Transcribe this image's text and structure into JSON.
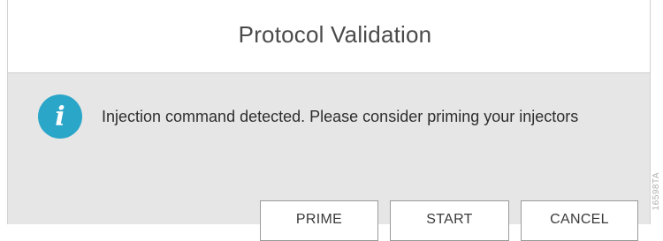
{
  "dialog": {
    "title": "Protocol Validation",
    "icon": "info-icon",
    "icon_glyph": "i",
    "icon_color": "#2aa6c8",
    "message": "Injection command detected. Please consider priming your injectors"
  },
  "buttons": {
    "prime_label": "PRIME",
    "start_label": "START",
    "cancel_label": "CANCEL"
  },
  "figure_id": "16598TA"
}
